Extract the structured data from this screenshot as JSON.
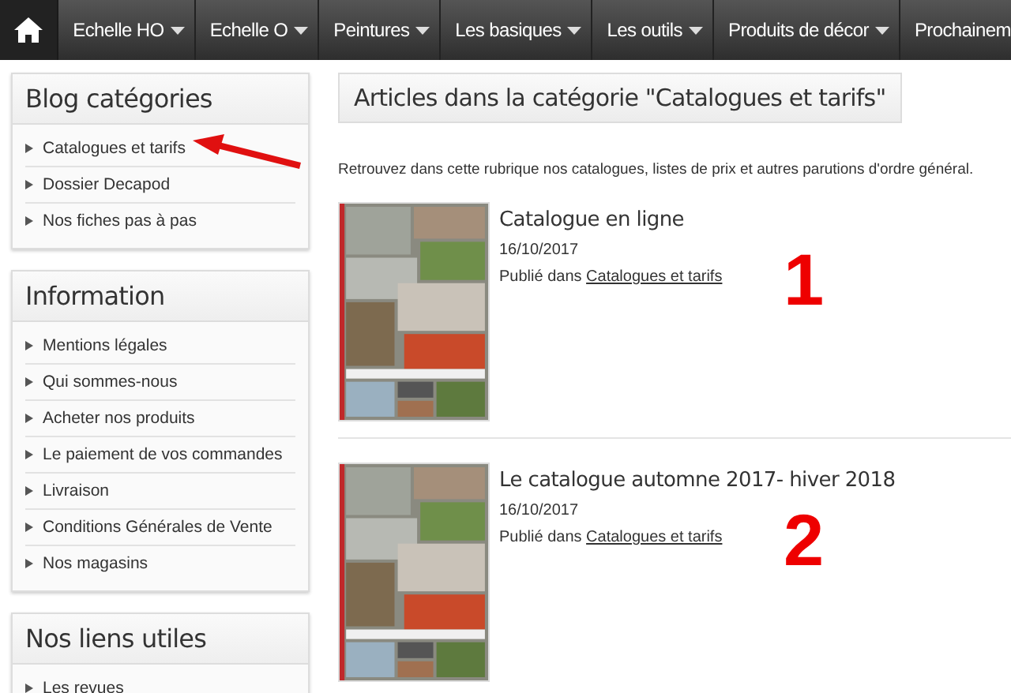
{
  "nav": {
    "items": [
      {
        "label": "Echelle HO",
        "dropdown": true
      },
      {
        "label": "Echelle O",
        "dropdown": true
      },
      {
        "label": "Peintures",
        "dropdown": true
      },
      {
        "label": "Les basiques",
        "dropdown": true
      },
      {
        "label": "Les outils",
        "dropdown": true
      },
      {
        "label": "Produits de décor",
        "dropdown": true
      },
      {
        "label": "Prochainem",
        "dropdown": false
      }
    ]
  },
  "sidebar": {
    "boxes": [
      {
        "title": "Blog catégories",
        "items": [
          {
            "label": "Catalogues et tarifs",
            "arrow": true
          },
          {
            "label": "Dossier Decapod",
            "arrow": false
          },
          {
            "label": "Nos fiches pas à pas",
            "arrow": false
          }
        ]
      },
      {
        "title": "Information",
        "items": [
          {
            "label": "Mentions légales",
            "arrow": false
          },
          {
            "label": "Qui sommes-nous",
            "arrow": false
          },
          {
            "label": "Acheter nos produits",
            "arrow": false
          },
          {
            "label": "Le paiement de vos commandes",
            "arrow": false
          },
          {
            "label": "Livraison",
            "arrow": false
          },
          {
            "label": "Conditions Générales de Vente",
            "arrow": false
          },
          {
            "label": "Nos magasins",
            "arrow": false
          }
        ]
      },
      {
        "title": "Nos liens utiles",
        "items": [
          {
            "label": "Les revues",
            "arrow": false
          }
        ]
      }
    ]
  },
  "main": {
    "heading": "Articles dans la catégorie \"Catalogues et tarifs\"",
    "intro": "Retrouvez dans cette rubrique nos catalogues, listes de prix et autres parutions d'ordre général.",
    "articles": [
      {
        "title": "Catalogue en ligne",
        "date": "16/10/2017",
        "published_prefix": "Publié dans",
        "category": "Catalogues et tarifs",
        "marker": "1"
      },
      {
        "title": "Le catalogue automne 2017- hiver 2018",
        "date": "16/10/2017",
        "published_prefix": "Publié dans",
        "category": "Catalogues et tarifs",
        "marker": "2"
      }
    ]
  }
}
